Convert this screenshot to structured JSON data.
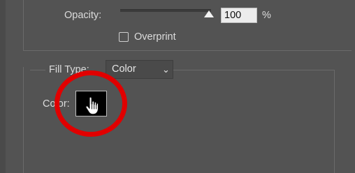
{
  "panel": {
    "opacity_label": "Opacity:",
    "opacity_value": "100",
    "percent_symbol": "%",
    "opacity_level_percent": 100,
    "overprint_label": "Overprint",
    "overprint_checked": false,
    "fill_type_label": "Fill Type:",
    "fill_type_value": "Color",
    "color_label": "Color:",
    "color_swatch_value": "#000000"
  },
  "annotation": {
    "highlight_color": "#e10000"
  },
  "icons": {
    "slider_thumb": "slider-thumb-icon",
    "dropdown": "chevron-down-icon",
    "cursor": "hand-pointer-icon"
  }
}
